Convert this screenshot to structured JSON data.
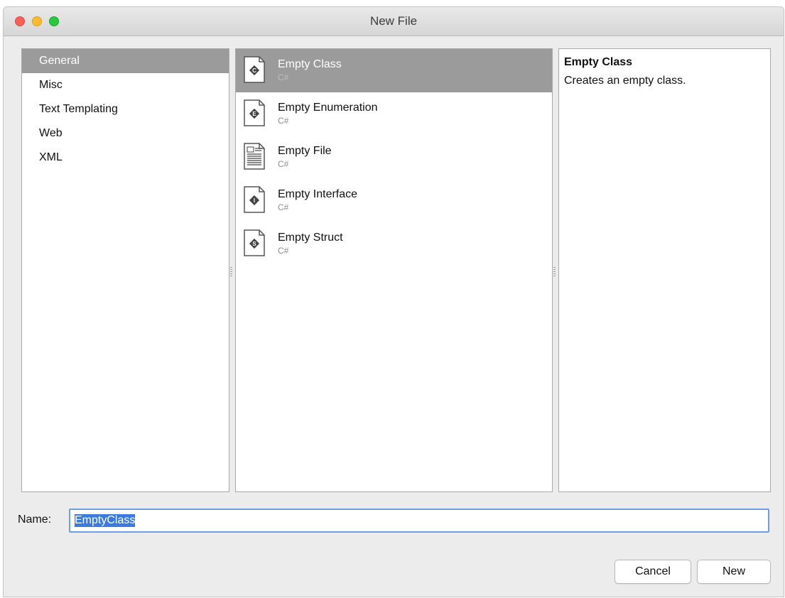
{
  "window": {
    "title": "New File"
  },
  "categories": {
    "items": [
      {
        "label": "General",
        "selected": true
      },
      {
        "label": "Misc"
      },
      {
        "label": "Text Templating"
      },
      {
        "label": "Web"
      },
      {
        "label": "XML"
      }
    ]
  },
  "templates": {
    "items": [
      {
        "name": "Empty Class",
        "lang": "C#",
        "icon": "class-file-icon",
        "selected": true
      },
      {
        "name": "Empty Enumeration",
        "lang": "C#",
        "icon": "enum-file-icon"
      },
      {
        "name": "Empty File",
        "lang": "C#",
        "icon": "text-file-icon"
      },
      {
        "name": "Empty Interface",
        "lang": "C#",
        "icon": "interface-file-icon"
      },
      {
        "name": "Empty Struct",
        "lang": "C#",
        "icon": "struct-file-icon"
      }
    ]
  },
  "description": {
    "title": "Empty Class",
    "text": "Creates an empty class."
  },
  "name_field": {
    "label": "Name:",
    "value": "EmptyClass"
  },
  "buttons": {
    "cancel": "Cancel",
    "new": "New"
  },
  "colors": {
    "selection_gray": "#9b9b9b",
    "focus_blue": "#6f9ee6",
    "close": "#fc5f57",
    "minimize": "#fdbc2e",
    "zoom": "#28c840"
  }
}
